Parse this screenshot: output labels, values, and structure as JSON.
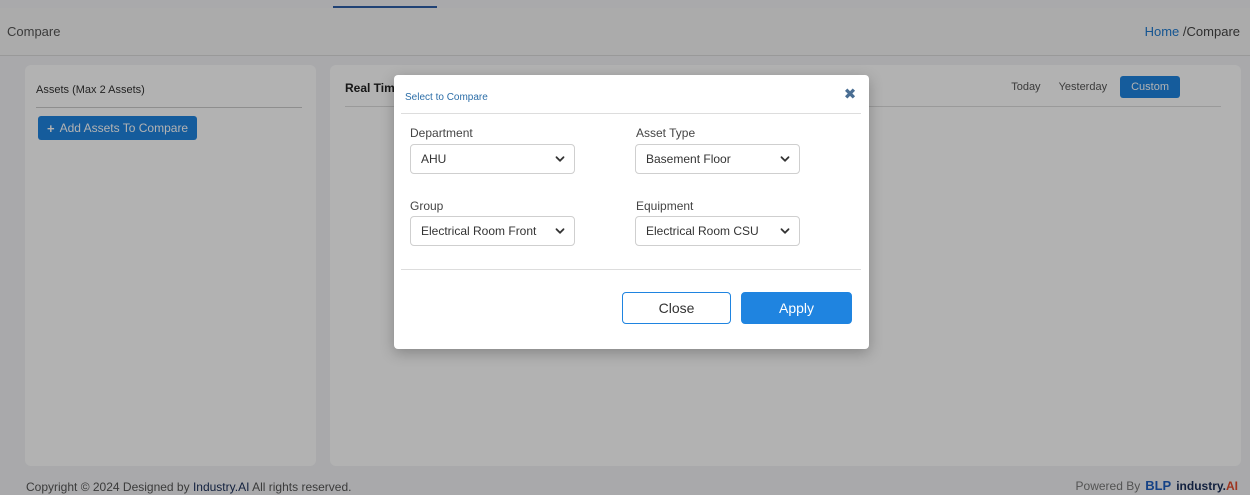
{
  "header": {
    "title": "Compare",
    "breadcrumb_home": "Home",
    "breadcrumb_separator": " /",
    "breadcrumb_current": "Compare"
  },
  "left_panel": {
    "title": "Assets (Max 2 Assets)",
    "add_button_label": "Add Assets To Compare",
    "add_button_icon": "plus-icon"
  },
  "right_panel": {
    "title": "Real Tim",
    "range_tabs": [
      {
        "label": "Today",
        "active": false
      },
      {
        "label": "Yesterday",
        "active": false
      },
      {
        "label": "Custom",
        "active": true
      }
    ]
  },
  "modal": {
    "title": "Select to Compare",
    "close_icon": "close-icon",
    "fields": {
      "department": {
        "label": "Department",
        "value": "AHU"
      },
      "asset_type": {
        "label": "Asset Type",
        "value": "Basement Floor"
      },
      "group": {
        "label": "Group",
        "value": "Electrical Room Front"
      },
      "equipment": {
        "label": "Equipment",
        "value": "Electrical Room CSU"
      }
    },
    "close_button": "Close",
    "apply_button": "Apply"
  },
  "footer": {
    "copyright_prefix": "Copyright © 2024 Designed by ",
    "copyright_brand": "Industry.AI",
    "copyright_suffix": " All rights reserved.",
    "powered_by": "Powered By",
    "powered_logo_1": "BLP",
    "powered_logo_2_main": "industry.",
    "powered_logo_2_ai": "AI"
  },
  "colors": {
    "accent": "#1f84e0",
    "brand_navy": "#1a2f5a",
    "brand_ai": "#e24b2b"
  }
}
